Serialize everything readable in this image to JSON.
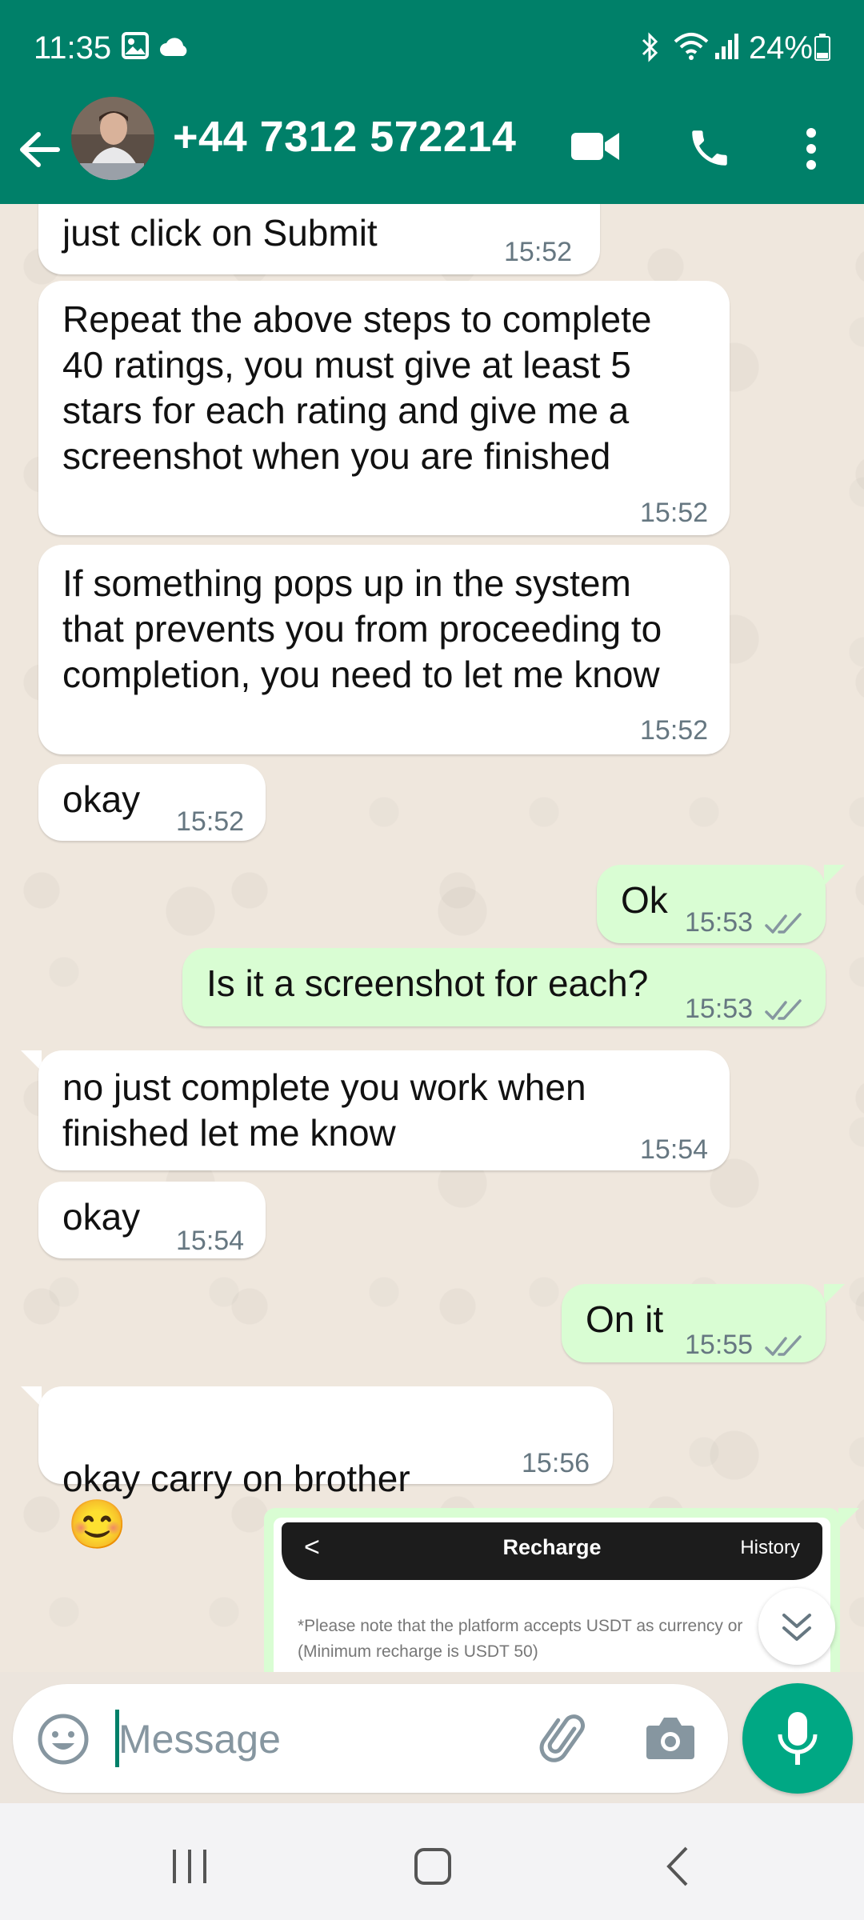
{
  "status_bar": {
    "time": "11:35",
    "battery": "24%"
  },
  "header": {
    "contact": "+44 7312 572214"
  },
  "messages": [
    {
      "text": "just click on Submit",
      "time": "15:52"
    },
    {
      "text": "Repeat the above steps to complete\n40 ratings, you must give at least 5\nstars for each rating and give me a\nscreenshot when you are finished",
      "time": "15:52"
    },
    {
      "text": "If something pops up in the system\nthat prevents you from proceeding to\ncompletion, you need to let me know",
      "time": "15:52"
    },
    {
      "text": "okay",
      "time": "15:52"
    },
    {
      "text": "Ok",
      "time": "15:53"
    },
    {
      "text": "Is it a screenshot for each?",
      "time": "15:53"
    },
    {
      "text": "no just complete you work when\nfinished let me know",
      "time": "15:54"
    },
    {
      "text": "okay",
      "time": "15:54"
    },
    {
      "text": "On it",
      "time": "15:55"
    },
    {
      "text": "okay carry on brother",
      "time": "15:56",
      "emoji": "😊"
    }
  ],
  "image_message": {
    "title": "Recharge",
    "history": "History",
    "back": "<",
    "note": "*Please note that the platform accepts USDT as currency or\n(Minimum recharge is USDT 50)"
  },
  "composer": {
    "placeholder": "Message"
  },
  "colors": {
    "header": "#008069",
    "outgoing_bubble": "#d9fdd3",
    "incoming_bubble": "#ffffff",
    "mic_button": "#00a884",
    "read_ticks": "#8696a0"
  }
}
